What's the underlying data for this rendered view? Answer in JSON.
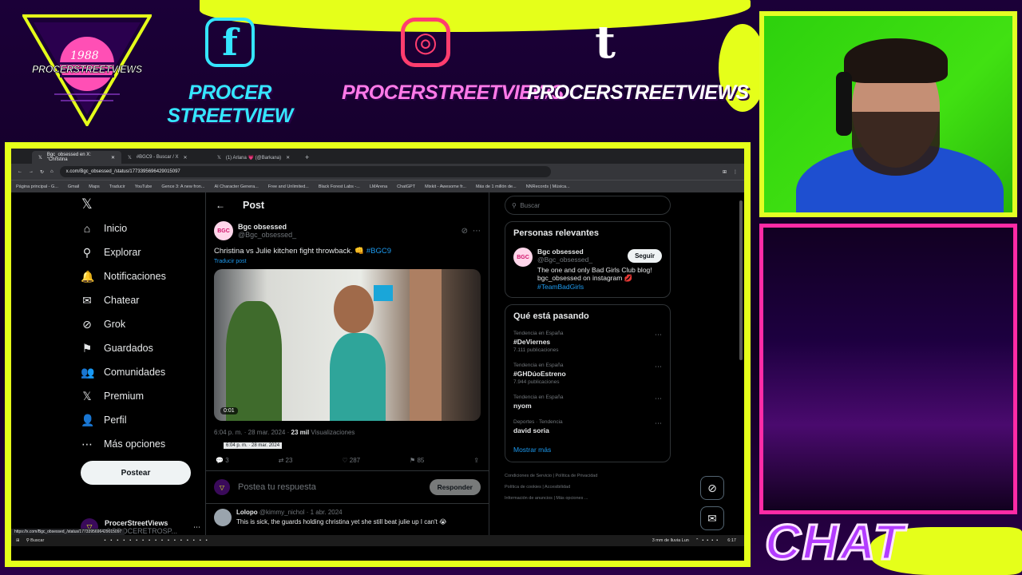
{
  "overlay": {
    "logo_year": "1988",
    "logo_name": "PROCERSTREETVIEWS",
    "socials": [
      {
        "icon": "facebook-icon",
        "glyph": "f",
        "label": "PROCER STREETVIEW"
      },
      {
        "icon": "instagram-icon",
        "glyph": "◎",
        "label": "PROCERSTREETVIEWS"
      },
      {
        "icon": "tumblr-icon",
        "glyph": "t",
        "label": "PROCERSTREETVIEWS"
      }
    ],
    "chat_label": "CHAT",
    "colors": {
      "accent_yellow": "#e5ff1a",
      "accent_pink": "#ff2ba6",
      "social_cyan": "#35e6ff",
      "social_pink": "#ff4fd8"
    }
  },
  "browser": {
    "tabs": [
      "Bgc_obsessed en X: \"Christina",
      "#BGC9 - Buscar / X",
      "(1) Arlana 💗 (@Barkana)"
    ],
    "url": "x.com/Bgc_obsessed_/status/1773395696429015097",
    "bookmarks": [
      "Página principal - G...",
      "Gmail",
      "Maps",
      "Traducir",
      "YouTube",
      "Gence 3: A new fron...",
      "AI Character Genera...",
      "Free and Unlimited...",
      "Black Forest Labs -...",
      "LMArena",
      "ChatGPT",
      "Mixkit - Awesome fr...",
      "Más de 1 millón de...",
      "NNRecords | Música..."
    ],
    "status_link": "https://x.com/Bgc_obsessed_/status/1773395696429015097"
  },
  "nav": {
    "items": [
      {
        "icon": "home-icon",
        "glyph": "⌂",
        "label": "Inicio"
      },
      {
        "icon": "search-icon",
        "glyph": "⚲",
        "label": "Explorar"
      },
      {
        "icon": "bell-icon",
        "glyph": "🔔",
        "label": "Notificaciones"
      },
      {
        "icon": "mail-icon",
        "glyph": "✉",
        "label": "Chatear"
      },
      {
        "icon": "grok-icon",
        "glyph": "⊘",
        "label": "Grok"
      },
      {
        "icon": "bookmark-icon",
        "glyph": "⚑",
        "label": "Guardados"
      },
      {
        "icon": "communities-icon",
        "glyph": "👥",
        "label": "Comunidades"
      },
      {
        "icon": "x-premium-icon",
        "glyph": "𝕏",
        "label": "Premium"
      },
      {
        "icon": "profile-icon",
        "glyph": "👤",
        "label": "Perfil"
      },
      {
        "icon": "more-icon",
        "glyph": "⋯",
        "label": "Más opciones"
      }
    ],
    "post_button": "Postear",
    "account_name": "ProcerStreetViews",
    "account_handle": "@PROCERETROSP..."
  },
  "post": {
    "header": "Post",
    "author": "Bgc obsessed",
    "handle": "@Bgc_obsessed_",
    "text": "Christina vs Julie kitchen fight throwback. 👊",
    "hashtag": "#BGC9",
    "translate": "Traducir post",
    "video_time": "0:01",
    "timestamp": "6:04 p. m. · 28 mar. 2024",
    "views_count": "23 mil",
    "views_label": "Visualizaciones",
    "tooltip": "6:04 p. m. · 28 mar. 2024",
    "replies": "3",
    "reposts": "23",
    "likes": "287",
    "bookmarks": "85",
    "reply_placeholder": "Postea tu respuesta",
    "reply_button": "Responder"
  },
  "reply": {
    "author": "Lolopo",
    "handle": "@kimmy_nichol",
    "date": "· 1 abr. 2024",
    "text": "This is sick, the guards holding christina yet she still beat julie up I can't 😭"
  },
  "sidebar": {
    "search_placeholder": "Buscar",
    "relevant_title": "Personas relevantes",
    "relevant_name": "Bgc obsessed",
    "relevant_handle": "@Bgc_obsessed_",
    "follow": "Seguir",
    "bio_line1": "The one and only Bad Girls Club blog!",
    "bio_line2": "bgc_obsessed on instagram 💋",
    "bio_tag": "#TeamBadGirls",
    "trending_title": "Qué está pasando",
    "trends": [
      {
        "context": "Tendencia en España",
        "name": "#DeViernes",
        "count": "7.111 publicaciones"
      },
      {
        "context": "Tendencia en España",
        "name": "#GHDúoEstreno",
        "count": "7.944 publicaciones"
      },
      {
        "context": "Tendencia en España",
        "name": "nyom",
        "count": ""
      },
      {
        "context": "Deportes · Tendencia",
        "name": "david soria",
        "count": ""
      }
    ],
    "show_more": "Mostrar más",
    "footer1": "Condiciones de Servicio  |  Política de Privacidad",
    "footer2": "Política de cookies  |  Accesibilidad",
    "footer3": "Información de anuncios  |  Más opciones ..."
  },
  "taskbar": {
    "search": "Buscar",
    "weather": "3 mm de lluvia Lun",
    "time": "6:17"
  }
}
